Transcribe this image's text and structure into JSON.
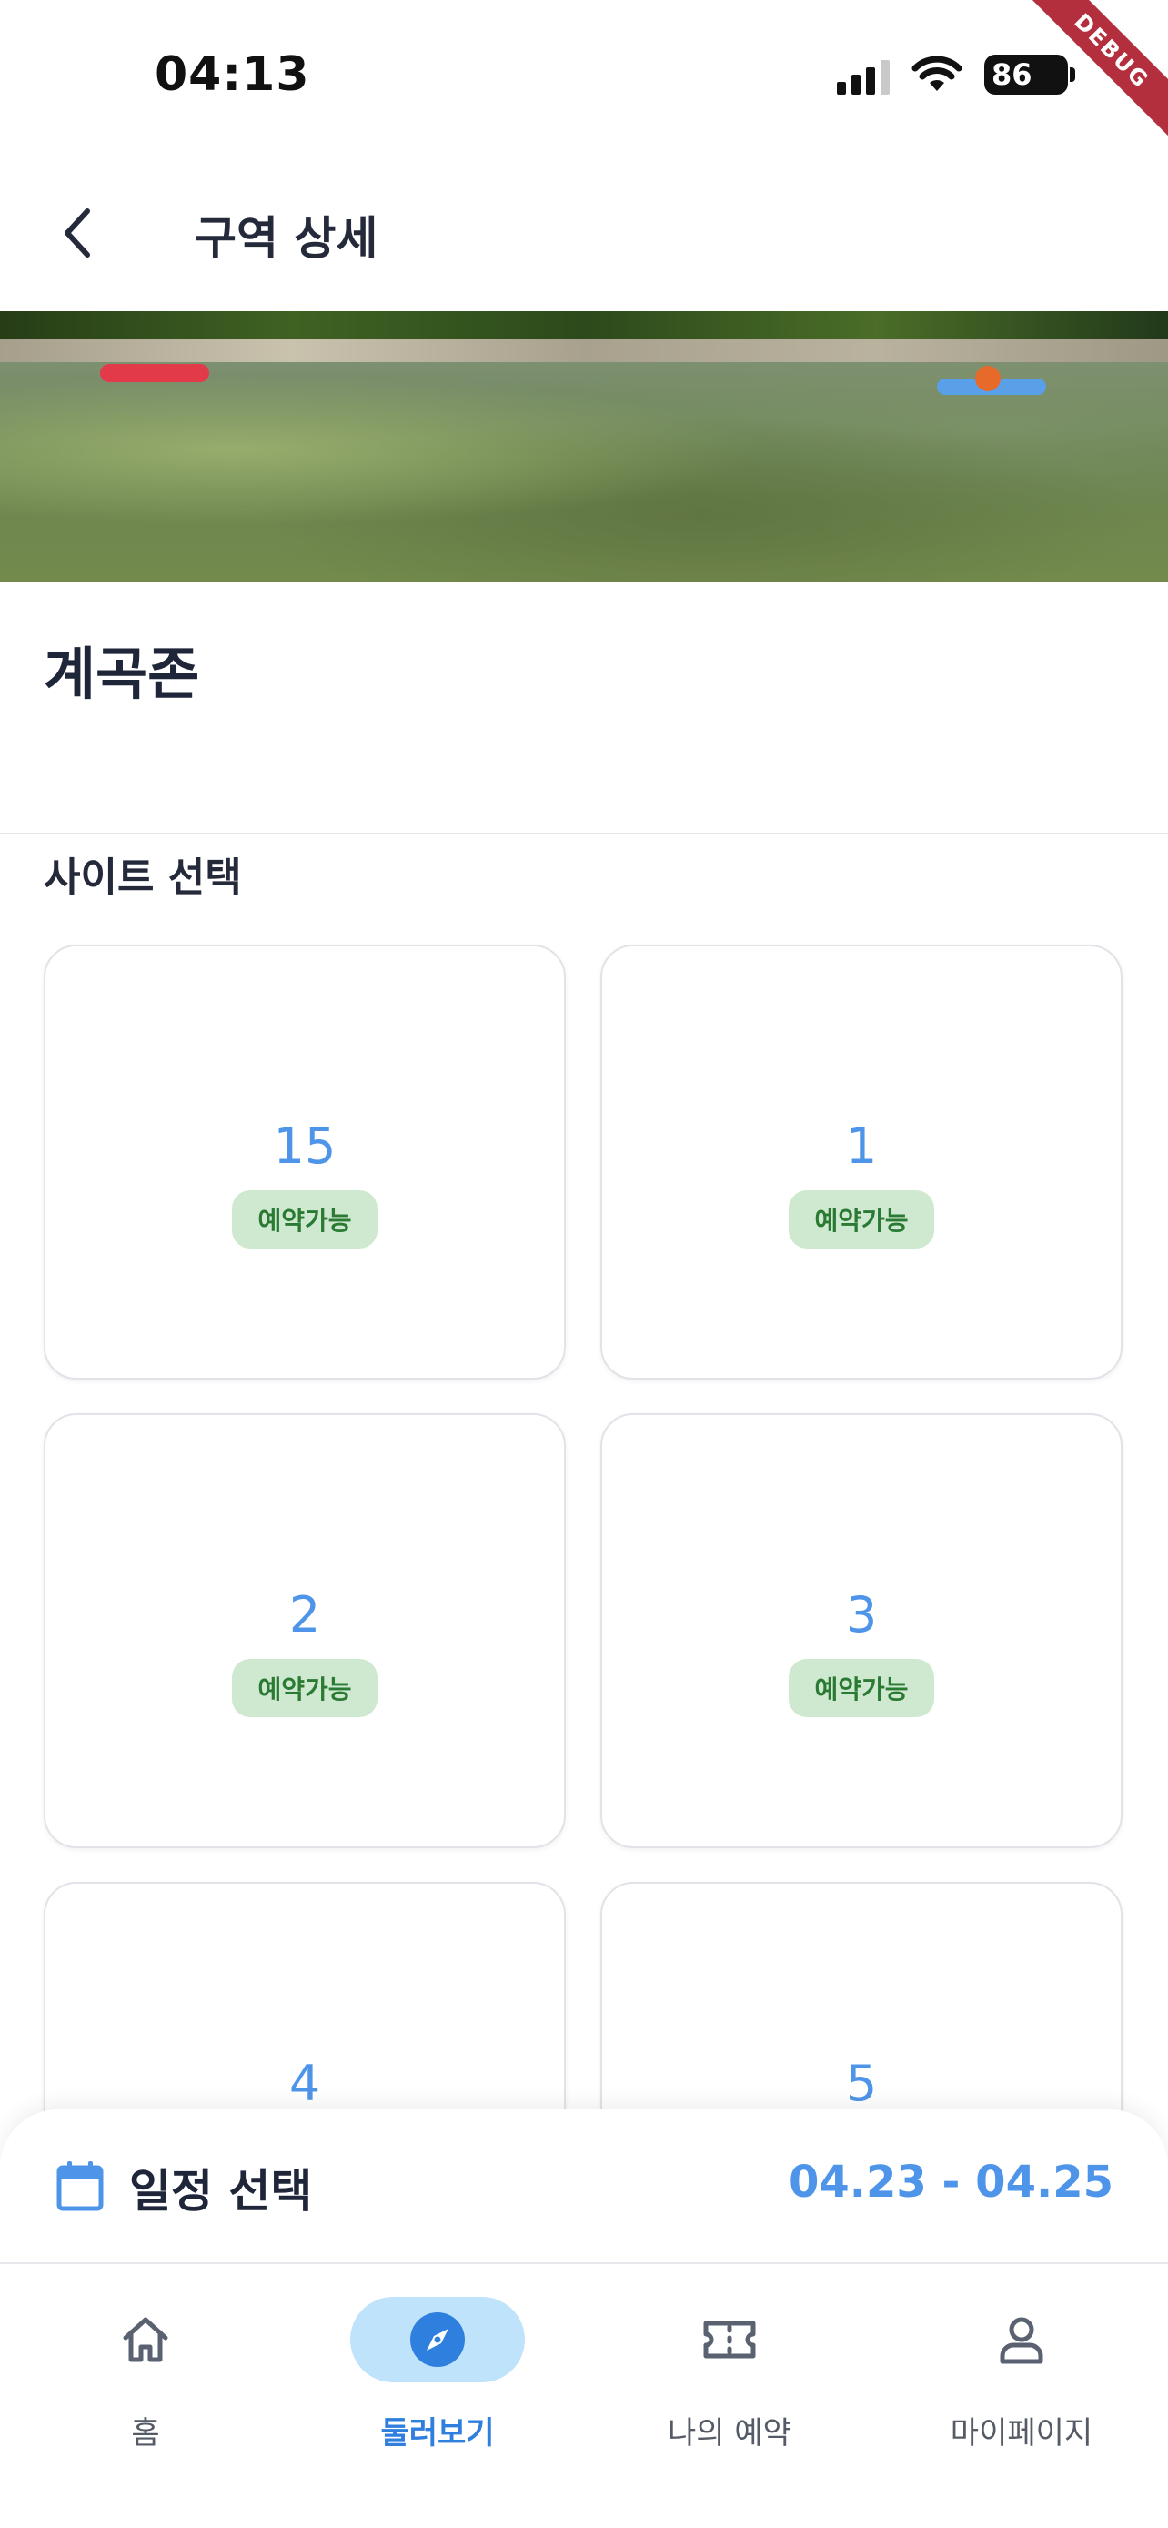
{
  "status_bar": {
    "time": "04:13",
    "battery": "86",
    "debug_banner": "DEBUG",
    "icons": [
      "cellular-signal-icon",
      "wifi-icon",
      "battery-charging-icon"
    ]
  },
  "app_bar": {
    "title": "구역 상세",
    "back_icon": "chevron-left-icon"
  },
  "zone": {
    "name": "계곡존"
  },
  "sites": {
    "section_title": "사이트 선택",
    "items": [
      {
        "number": "15",
        "status": "예약가능"
      },
      {
        "number": "1",
        "status": "예약가능"
      },
      {
        "number": "2",
        "status": "예약가능"
      },
      {
        "number": "3",
        "status": "예약가능"
      },
      {
        "number": "4",
        "status": ""
      },
      {
        "number": "5",
        "status": ""
      }
    ]
  },
  "schedule": {
    "label": "일정 선택",
    "dates": "04.23 - 04.25",
    "icon": "calendar-icon"
  },
  "bottom_nav": {
    "items": [
      {
        "label": "홈",
        "icon": "home-icon",
        "active": false
      },
      {
        "label": "둘러보기",
        "icon": "compass-icon",
        "active": true
      },
      {
        "label": "나의 예약",
        "icon": "ticket-icon",
        "active": false
      },
      {
        "label": "마이페이지",
        "icon": "person-icon",
        "active": false
      }
    ]
  },
  "colors": {
    "accent": "#4e94e8",
    "badge_bg": "#cfe9d0",
    "badge_text": "#2b7a34",
    "active_pill": "#bfe3fb"
  }
}
